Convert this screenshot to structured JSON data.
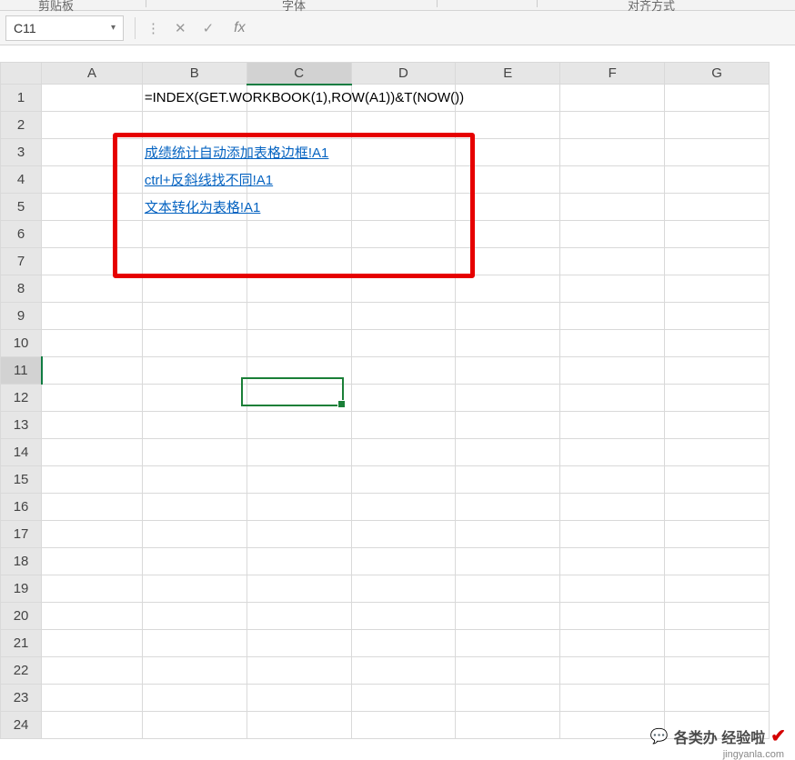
{
  "ribbon": {
    "group1": "剪贴板",
    "group2": "字体",
    "group3": "对齐方式"
  },
  "namebox": {
    "value": "C11"
  },
  "formula": {
    "value": ""
  },
  "columns": [
    "A",
    "B",
    "C",
    "D",
    "E",
    "F",
    "G"
  ],
  "rows": [
    "1",
    "2",
    "3",
    "4",
    "5",
    "6",
    "7",
    "8",
    "9",
    "10",
    "11",
    "12",
    "13",
    "14",
    "15",
    "16",
    "17",
    "18",
    "19",
    "20",
    "21",
    "22",
    "23",
    "24"
  ],
  "cells": {
    "B1": "=INDEX(GET.WORKBOOK(1),ROW(A1))&T(NOW())",
    "B3": "成绩统计自动添加表格边框!A1",
    "B4": "ctrl+反斜线找不同!A1",
    "B5": "文本转化为表格!A1"
  },
  "selection": {
    "cell": "C11"
  },
  "watermark": {
    "text": "各类办 经验啦",
    "url": "jingyanla.com"
  }
}
